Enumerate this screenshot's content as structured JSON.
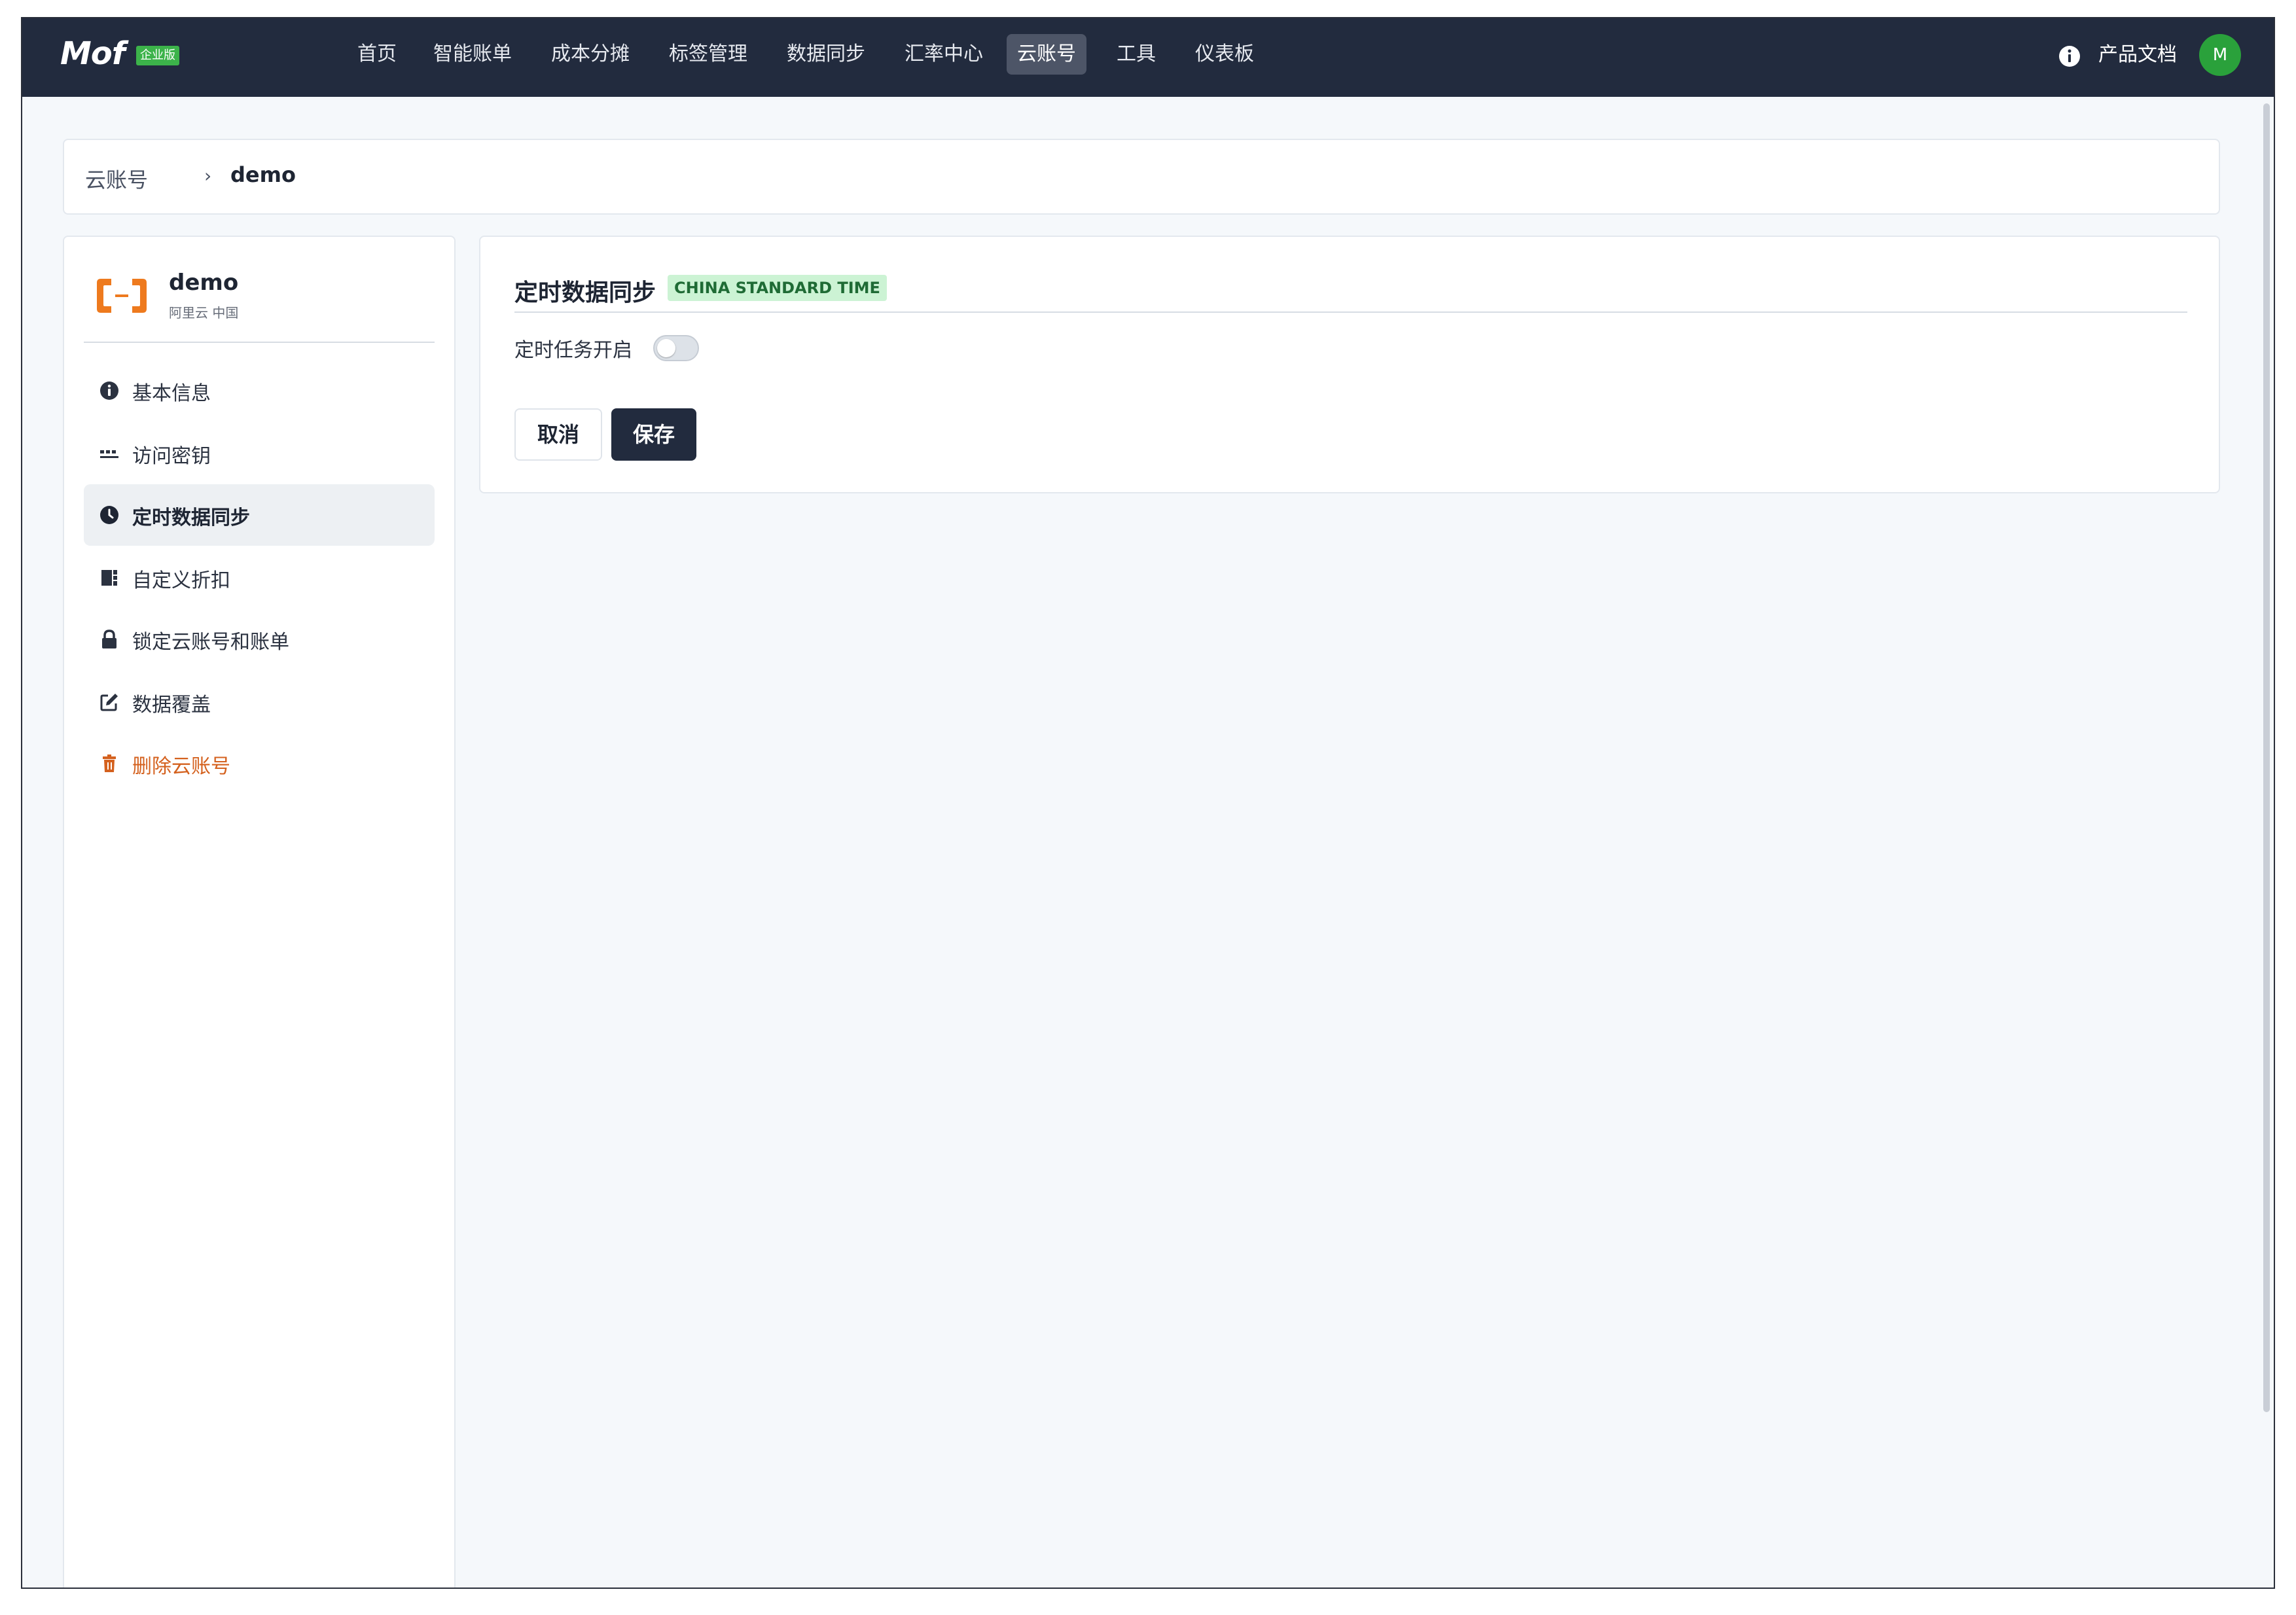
{
  "topnav": {
    "logo": "Mof",
    "edition_badge": "企业版",
    "items": [
      {
        "label": "首页"
      },
      {
        "label": "智能账单"
      },
      {
        "label": "成本分摊"
      },
      {
        "label": "标签管理"
      },
      {
        "label": "数据同步"
      },
      {
        "label": "汇率中心"
      },
      {
        "label": "云账号",
        "active": true
      },
      {
        "label": "工具"
      },
      {
        "label": "仪表板"
      }
    ],
    "docs_label": "产品文档",
    "avatar_initial": "M"
  },
  "breadcrumb": {
    "root": "云账号",
    "separator": "›",
    "current": "demo"
  },
  "account": {
    "name": "demo",
    "subtitle": "阿里云 中国",
    "logo_icon": "aliyun-logo-icon"
  },
  "sidebar": {
    "items": [
      {
        "label": "基本信息",
        "icon": "info-circle-icon"
      },
      {
        "label": "访问密钥",
        "icon": "key-dots-icon"
      },
      {
        "label": "定时数据同步",
        "icon": "clock-icon",
        "active": true
      },
      {
        "label": "自定义折扣",
        "icon": "discount-ticket-icon"
      },
      {
        "label": "锁定云账号和账单",
        "icon": "lock-icon"
      },
      {
        "label": "数据覆盖",
        "icon": "edit-icon"
      },
      {
        "label": "删除云账号",
        "icon": "trash-icon",
        "danger": true
      }
    ]
  },
  "main": {
    "title": "定时数据同步",
    "timezone_badge": "CHINA STANDARD TIME",
    "toggle_label": "定时任务开启",
    "toggle_on": false,
    "cancel_label": "取消",
    "save_label": "保存"
  },
  "colors": {
    "nav_bg": "#222b3e",
    "accent_green": "#3cb34a",
    "danger_orange": "#d4611e",
    "badge_bg": "#ccf3d4",
    "aliyun_orange": "#ee7a1e"
  }
}
